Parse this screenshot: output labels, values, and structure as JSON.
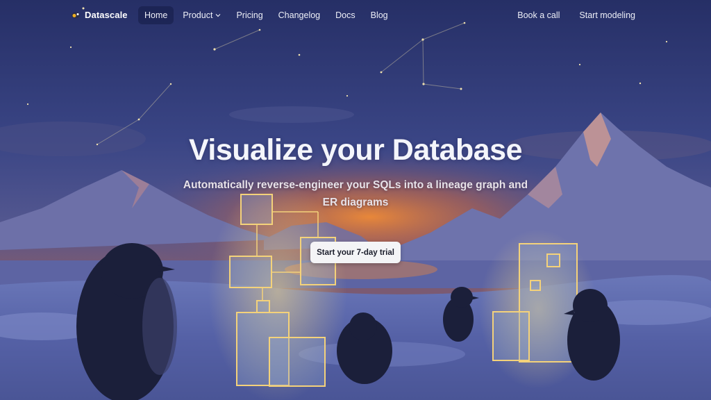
{
  "brand": {
    "name": "Datascale",
    "icon": "datascale-logo-icon"
  },
  "nav": {
    "links": [
      {
        "label": "Home",
        "active": true
      },
      {
        "label": "Product",
        "has_dropdown": true
      },
      {
        "label": "Pricing"
      },
      {
        "label": "Changelog"
      },
      {
        "label": "Docs"
      },
      {
        "label": "Blog"
      }
    ],
    "right": [
      {
        "label": "Book a call"
      },
      {
        "label": "Start modeling"
      }
    ]
  },
  "hero": {
    "title": "Visualize your Database",
    "subtitle": "Automatically reverse-engineer your SQLs into a lineage graph and ER diagrams",
    "cta_label": "Start your 7-day trial"
  },
  "colors": {
    "sky_top": "#2a336c",
    "sky_mid": "#3b4a8c",
    "sunset": "#e07a33",
    "glow": "#f4d27a",
    "snow": "#8e9ad0",
    "penguin": "#1b1f3a"
  }
}
